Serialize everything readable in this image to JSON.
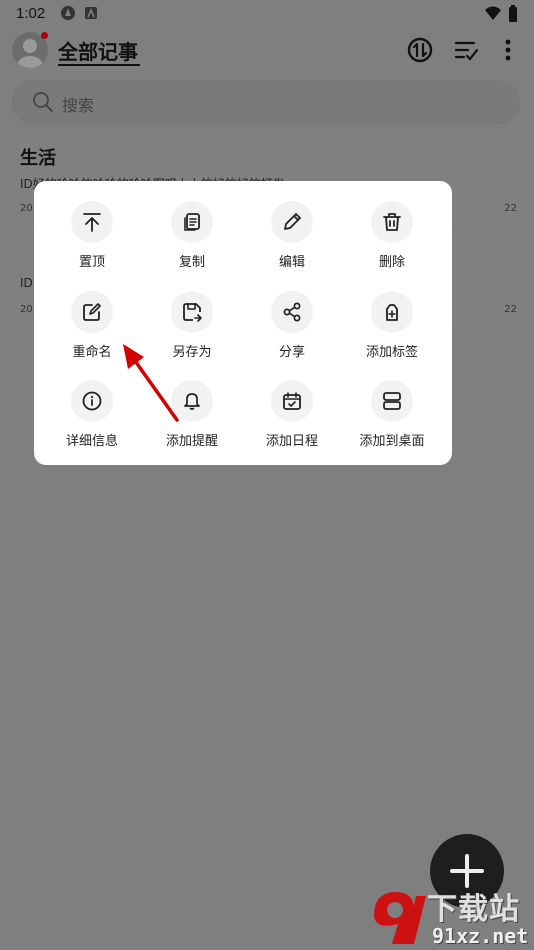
{
  "status_bar": {
    "time": "1:02"
  },
  "header": {
    "title": "全部记事"
  },
  "search": {
    "placeholder": "搜索"
  },
  "notes": [
    {
      "title": "生活",
      "body": "ID好的哈哈的哈哈的哈哈啊呀上上的好的好的打发",
      "date": "20",
      "count": "22"
    },
    {
      "title": "",
      "body": "ID",
      "date": "20",
      "count": "22"
    }
  ],
  "menu": {
    "items": [
      {
        "label": "置顶",
        "icon": "pin-top-icon"
      },
      {
        "label": "复制",
        "icon": "copy-icon"
      },
      {
        "label": "编辑",
        "icon": "pencil-icon"
      },
      {
        "label": "删除",
        "icon": "trash-icon"
      },
      {
        "label": "重命名",
        "icon": "rename-icon"
      },
      {
        "label": "另存为",
        "icon": "save-as-icon"
      },
      {
        "label": "分享",
        "icon": "share-icon"
      },
      {
        "label": "添加标签",
        "icon": "add-tag-icon"
      },
      {
        "label": "详细信息",
        "icon": "info-icon"
      },
      {
        "label": "添加提醒",
        "icon": "bell-icon"
      },
      {
        "label": "添加日程",
        "icon": "calendar-icon"
      },
      {
        "label": "添加到桌面",
        "icon": "desktop-widget-icon"
      }
    ]
  },
  "watermark": {
    "line1": "下载站",
    "line2": "91xz.net"
  },
  "colors": {
    "annotation_arrow": "#d40000",
    "overlay": "#7f7f7f",
    "popup": "#ffffff"
  }
}
